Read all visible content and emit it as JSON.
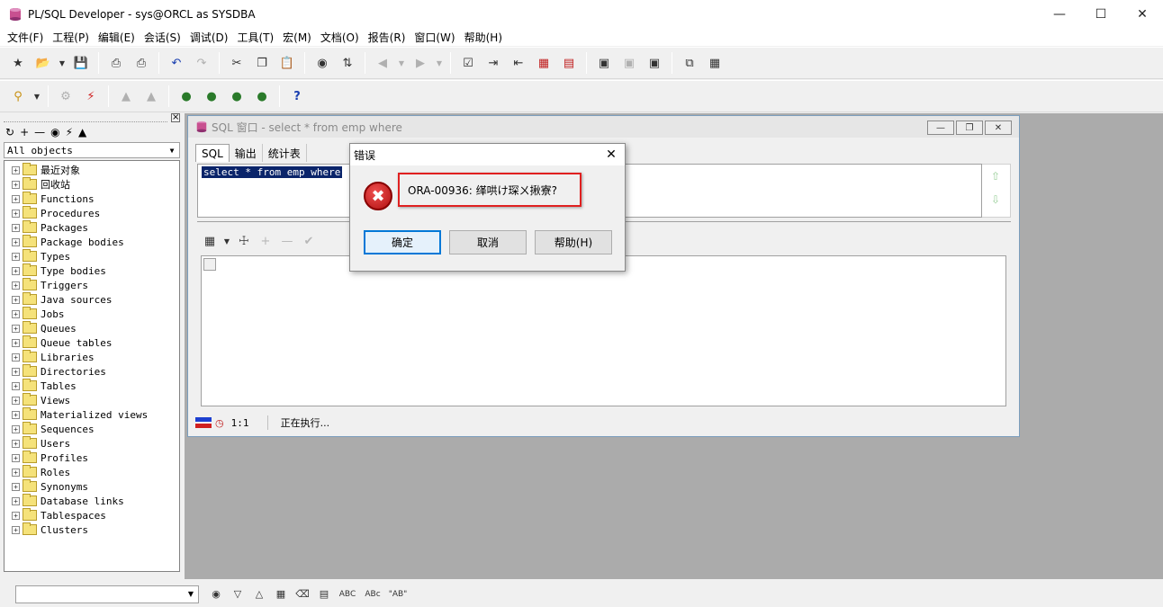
{
  "window": {
    "title": "PL/SQL Developer - sys@ORCL as SYSDBA"
  },
  "menu": [
    "文件(F)",
    "工程(P)",
    "编辑(E)",
    "会话(S)",
    "调试(D)",
    "工具(T)",
    "宏(M)",
    "文档(O)",
    "报告(R)",
    "窗口(W)",
    "帮助(H)"
  ],
  "object_browser": {
    "filter_value": "All objects",
    "tree": [
      "最近对象",
      "回收站",
      "Functions",
      "Procedures",
      "Packages",
      "Package bodies",
      "Types",
      "Type bodies",
      "Triggers",
      "Java sources",
      "Jobs",
      "Queues",
      "Queue tables",
      "Libraries",
      "Directories",
      "Tables",
      "Views",
      "Materialized views",
      "Sequences",
      "Users",
      "Profiles",
      "Roles",
      "Synonyms",
      "Database links",
      "Tablespaces",
      "Clusters"
    ]
  },
  "sql_window": {
    "title": "SQL 窗口 - select * from emp where",
    "tabs": [
      "SQL",
      "输出",
      "统计表"
    ],
    "active_tab": "SQL",
    "code": "select * from emp where",
    "status": {
      "position": "1:1",
      "text": "正在执行..."
    }
  },
  "dialog": {
    "title": "错误",
    "message": "ORA-00936: 缂哄け琛ㄨ揪寮?",
    "buttons": {
      "ok": "确定",
      "cancel": "取消",
      "help": "帮助(H)"
    },
    "highlight_color": "#e02020"
  },
  "bottom_toolbar": {
    "labels": [
      "ABC",
      "ABc",
      "\"AB\""
    ]
  },
  "colors": {
    "selection_bg": "#0a246a",
    "mdi_bg": "#ababab",
    "default_button_border": "#0078d7"
  }
}
